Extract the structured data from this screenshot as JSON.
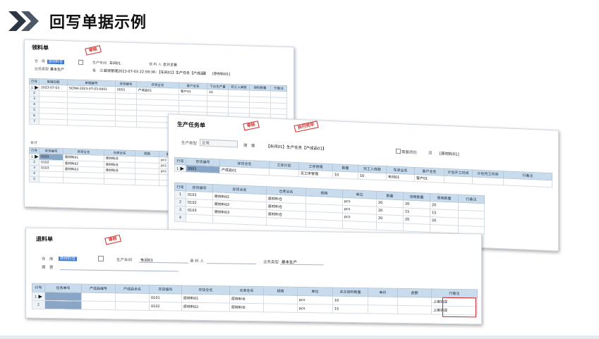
{
  "page": {
    "title": "回写单据示例"
  },
  "lingliao": {
    "title": "领料单",
    "stamp": "审核",
    "fields": {
      "warehouse_label": "仓　库",
      "warehouse_value": "原材料仓",
      "workshop_label": "生产车间",
      "workshop_value": "车间01",
      "picker_label": "领 料 人",
      "picker_value": "会计主管",
      "biz_type_label": "业务类型",
      "biz_type_value": "基本生产",
      "remark_label": "备　注",
      "remark_value": "超领管理2023-07-03 22:59:36：【车间01】生产任务【产成品】",
      "source_label": "源",
      "source_value": "[原材料01]"
    },
    "grid1": {
      "headers": [
        "行号",
        "单据日期",
        "单据编号",
        "存货编号",
        "存货全名",
        "客户全名",
        "下达生产量",
        "完工入库数",
        "领料数量",
        "行备注"
      ],
      "rows": [
        [
          "1",
          "2023-07-03",
          "SCRW-2023-07-03-0001",
          "0001",
          "产成品01",
          "客户01",
          "10",
          "",
          "",
          ""
        ],
        [
          "2",
          "",
          "",
          "",
          "",
          "",
          "",
          "",
          "",
          ""
        ],
        [
          "3",
          "",
          "",
          "",
          "",
          "",
          "",
          "",
          "",
          ""
        ],
        [
          "4",
          "",
          "",
          "",
          "",
          "",
          "",
          "",
          "",
          ""
        ],
        [
          "5",
          "",
          "",
          "",
          "",
          "",
          "",
          "",
          "",
          ""
        ],
        [
          "6",
          "",
          "",
          "",
          "",
          "",
          "",
          "",
          "",
          ""
        ],
        [
          "7",
          "",
          "",
          "",
          "",
          "",
          "",
          "",
          "",
          ""
        ]
      ],
      "total_label": "合计"
    },
    "grid2": {
      "headers": [
        "行号",
        "存货编号",
        "存货全名",
        "仓库全名",
        "规格",
        "单"
      ],
      "rows": [
        [
          "1",
          "0101",
          "原材料01",
          "原材料仓",
          "",
          "pcs"
        ],
        [
          "2",
          "0102",
          "原材料02",
          "原材料仓",
          "",
          "pcs"
        ],
        [
          "3",
          "0103",
          "原材料03",
          "原材料仓",
          "",
          "pcs"
        ],
        [
          "4",
          "",
          "",
          "",
          "",
          ""
        ],
        [
          "5",
          "",
          "",
          "",
          "",
          ""
        ]
      ]
    }
  },
  "renwu": {
    "title": "生产任务单",
    "stamp1": "审核",
    "stamp2": "执行完毕",
    "fields": {
      "type_label": "生产类型",
      "type_value": "正常",
      "remark_label": "摘　要",
      "remark_value": "【车间01】生产任务【产成品01】",
      "need_qc_label": "需要质检",
      "source_label": "须",
      "source_value": "[原材料01]"
    },
    "grid1": {
      "headers": [
        "行号",
        "存货编号",
        "存货全名",
        "工序计划",
        "工序管理",
        "数量",
        "完工入库数",
        "车间全名",
        "客户全名",
        "计划开工时间",
        "计划完工时间",
        "行备注"
      ],
      "rows": [
        [
          "1",
          "0001",
          "产成品01",
          "",
          "无工序管理",
          "10",
          "10",
          "车间01",
          "客户01",
          "",
          "",
          ""
        ]
      ]
    },
    "grid2": {
      "headers": [
        "行号",
        "存货编号",
        "存货全名",
        "仓库全名",
        "规格",
        "单位",
        "数量",
        "领用数量",
        "使用数量",
        "行备注"
      ],
      "rows": [
        [
          "1",
          "0101",
          "原材料01",
          "原材料仓",
          "",
          "pcs",
          "20",
          "20",
          "20",
          ""
        ],
        [
          "2",
          "0102",
          "原材料02",
          "原材料仓",
          "",
          "pcs",
          "20",
          "15",
          "15",
          ""
        ],
        [
          "3",
          "0103",
          "原材料03",
          "原材料仓",
          "",
          "pcs",
          "20",
          "20",
          "20",
          ""
        ],
        [
          "4",
          "",
          "",
          "",
          "",
          "",
          "",
          "",
          "",
          ""
        ]
      ]
    }
  },
  "tuiliao": {
    "title": "退料单",
    "stamp": "审核",
    "fields": {
      "warehouse_label": "仓　库",
      "warehouse_value": "原材料仓",
      "workshop_label": "生产车间",
      "workshop_value": "车间01",
      "returner_label": "退 料 人",
      "returner_value": "",
      "biz_type_label": "业务类型",
      "biz_type_value": "基本生产",
      "remark_label": "摘　要",
      "remark_value": ""
    },
    "grid": {
      "headers": [
        "行号",
        "任务单号",
        "产成品编号",
        "产成品全名",
        "存货编号",
        "存货全名",
        "仓库全名",
        "规格",
        "单位",
        "本次退料数量",
        "单价",
        "金额",
        "行备注"
      ],
      "rows": [
        [
          "1",
          "",
          "",
          "",
          "0101",
          "原材料01",
          "原材料仓",
          "",
          "pcs",
          "10",
          "",
          "",
          "上架完成"
        ],
        [
          "2",
          "",
          "",
          "",
          "0102",
          "原材料02",
          "原材料仓",
          "",
          "pcs",
          "15",
          "",
          "",
          "上架完成"
        ]
      ]
    }
  },
  "colors": {
    "accent": "#2b3642",
    "header_blue": "#c9dced",
    "stamp_red": "#c9302c",
    "highlight_red": "#d0252a"
  }
}
